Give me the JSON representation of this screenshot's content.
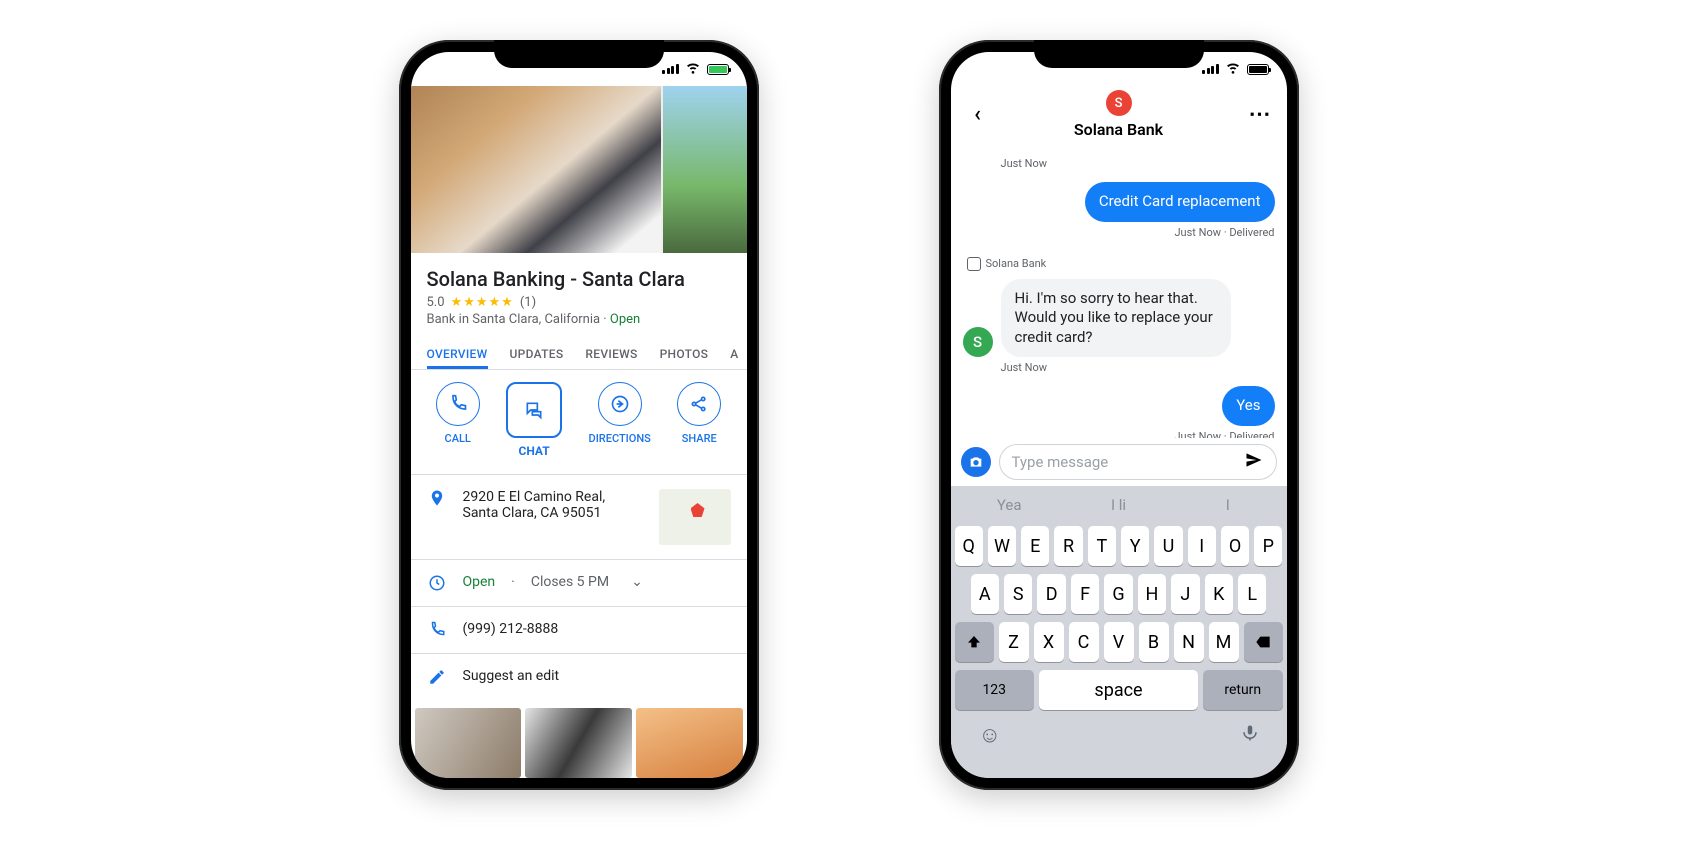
{
  "phone1": {
    "business_name": "Solana Banking - Santa Clara",
    "rating_value": "5.0",
    "rating_count": "(1)",
    "category_line": "Bank in Santa Clara, California",
    "open_status": "Open",
    "tabs": {
      "overview": "OVERVIEW",
      "updates": "UPDATES",
      "reviews": "REVIEWS",
      "photos": "PHOTOS",
      "about_partial": "A"
    },
    "actions": {
      "call": "CALL",
      "chat": "CHAT",
      "directions": "DIRECTIONS",
      "share": "SHARE"
    },
    "address": "2920 E El Camino Real, Santa Clara, CA 95051",
    "hours": {
      "status": "Open",
      "separator": "·",
      "closes": "Closes 5 PM"
    },
    "phone": "(999) 212-8888",
    "suggest_edit": "Suggest an edit"
  },
  "phone2": {
    "header": {
      "avatar_letter": "S",
      "title": "Solana Bank"
    },
    "messages": {
      "ts1": "Just Now",
      "outgoing1": "Credit Card replacement",
      "ts2": "Just Now · Delivered",
      "sender_label": "Solana Bank",
      "incoming1": "Hi. I'm so sorry to hear that. Would you like to replace your credit card?",
      "incoming_avatar": "S",
      "ts3": "Just Now",
      "outgoing2": "Yes",
      "ts4": "Just Now · Delivered"
    },
    "composer": {
      "placeholder": "Type message"
    },
    "keyboard": {
      "suggestions": {
        "s1": "Yea",
        "s2": "I li",
        "s3": "I"
      },
      "row1": [
        "Q",
        "W",
        "E",
        "R",
        "T",
        "Y",
        "U",
        "I",
        "O",
        "P"
      ],
      "row2": [
        "A",
        "S",
        "D",
        "F",
        "G",
        "H",
        "J",
        "K",
        "L"
      ],
      "row3": [
        "Z",
        "X",
        "C",
        "V",
        "B",
        "N",
        "M"
      ],
      "num": "123",
      "space": "space",
      "return": "return"
    }
  }
}
